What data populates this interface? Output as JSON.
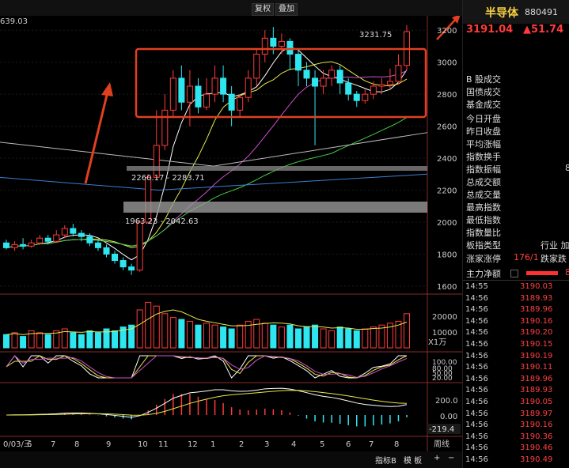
{
  "toolbar": {
    "fq_label": "复权",
    "overlay_label": "叠加"
  },
  "corner_value": "639.03",
  "colors": {
    "up": "#ff3b3b",
    "down": "#2ee6f0",
    "ma5": "#ffffff",
    "ma10": "#e8e84a",
    "ma20": "#d050d0",
    "ma60": "#40d040",
    "annotation": "#e04020",
    "background": "#000000"
  },
  "main_axis": {
    "ticks": [
      "3200",
      "3000",
      "2800",
      "2600",
      "2400",
      "2200",
      "2000",
      "1800",
      "1600"
    ]
  },
  "annotations": {
    "high_label": "3231.75",
    "band1": "2260.17 - 2283.71",
    "band2": "1963.23 - 2042.63"
  },
  "volume_axis": {
    "ticks": [
      "20000",
      "10000"
    ],
    "unit": "X1万"
  },
  "kdj_axis": {
    "ticks": [
      "100.00",
      "80.00",
      "50.00",
      "20.00"
    ]
  },
  "macd_axis": {
    "ticks": [
      "200.0",
      "0.00"
    ],
    "value": "-219.4"
  },
  "x_axis": {
    "labels": [
      "0/03/三",
      "6",
      "7",
      "8",
      "9",
      "10",
      "11",
      "12",
      "1",
      "2",
      "3",
      "4",
      "5",
      "6",
      "7",
      "8"
    ]
  },
  "bottom": {
    "indicator_label": "指标B",
    "template_label": "模 板",
    "period_label": "周线",
    "plus": "+",
    "minus": "−"
  },
  "panel": {
    "name": "半导体",
    "code": "880491",
    "price": "3191.04",
    "change": "▲51.74",
    "labels": [
      "B 股成交",
      "国债成交",
      "基金成交",
      "今日开盘",
      "昨日收盘",
      "平均涨幅",
      "指数换手",
      "指数振幅",
      "总成交额",
      "总成交量",
      "最高指数",
      "最低指数",
      "指数量比"
    ],
    "zhenfu_value": "8",
    "industry_label": "板指类型",
    "industry_value": "行业 加",
    "limit_label": "涨家涨停",
    "limit_value": "176/1",
    "limit_extra": "跌家跌",
    "capital_label": "主力净额",
    "capital_value": "8",
    "ticks": [
      {
        "time": "14:55",
        "price": "3190.03"
      },
      {
        "time": "14:56",
        "price": "3189.93"
      },
      {
        "time": "14:56",
        "price": "3189.96"
      },
      {
        "time": "14:56",
        "price": "3190.16"
      },
      {
        "time": "14:56",
        "price": "3190.20"
      },
      {
        "time": "14:56",
        "price": "3190.15"
      },
      {
        "time": "14:56",
        "price": "3190.19"
      },
      {
        "time": "14:56",
        "price": "3190.11"
      },
      {
        "time": "14:56",
        "price": "3189.96"
      },
      {
        "time": "14:56",
        "price": "3189.93"
      },
      {
        "time": "14:56",
        "price": "3190.05"
      },
      {
        "time": "14:56",
        "price": "3189.97"
      },
      {
        "time": "14:56",
        "price": "3190.16"
      },
      {
        "time": "14:56",
        "price": "3190.36"
      },
      {
        "time": "14:56",
        "price": "3190.46"
      },
      {
        "time": "14:56",
        "price": "3190.49"
      }
    ]
  },
  "chart_data": {
    "type": "candlestick",
    "title": "",
    "ylim": [
      1560,
      3290
    ],
    "candles": [
      [
        1870,
        1840,
        1890,
        1830
      ],
      [
        1840,
        1860,
        1880,
        1820
      ],
      [
        1860,
        1850,
        1900,
        1830
      ],
      [
        1850,
        1870,
        1890,
        1840
      ],
      [
        1870,
        1900,
        1920,
        1860
      ],
      [
        1900,
        1880,
        1920,
        1860
      ],
      [
        1880,
        1920,
        1950,
        1870
      ],
      [
        1920,
        1960,
        1980,
        1900
      ],
      [
        1960,
        1930,
        1990,
        1910
      ],
      [
        1930,
        1910,
        1950,
        1880
      ],
      [
        1910,
        1870,
        1930,
        1850
      ],
      [
        1870,
        1840,
        1890,
        1820
      ],
      [
        1840,
        1800,
        1860,
        1780
      ],
      [
        1800,
        1760,
        1820,
        1740
      ],
      [
        1760,
        1720,
        1780,
        1700
      ],
      [
        1720,
        1700,
        1740,
        1670
      ],
      [
        1700,
        2000,
        2010,
        1690
      ],
      [
        2000,
        2280,
        2300,
        1990
      ],
      [
        2280,
        2480,
        2700,
        2260
      ],
      [
        2480,
        2700,
        2800,
        2450
      ],
      [
        2700,
        2900,
        2950,
        2650
      ],
      [
        2900,
        2750,
        2980,
        2700
      ],
      [
        2750,
        2850,
        2950,
        2600
      ],
      [
        2850,
        2720,
        2900,
        2680
      ],
      [
        2720,
        2800,
        2900,
        2700
      ],
      [
        2800,
        2900,
        2980,
        2750
      ],
      [
        2900,
        2800,
        2980,
        2750
      ],
      [
        2800,
        2700,
        2850,
        2600
      ],
      [
        2700,
        2780,
        2800,
        2650
      ],
      [
        2780,
        2900,
        2950,
        2750
      ],
      [
        2900,
        3050,
        3080,
        2850
      ],
      [
        3050,
        3150,
        3200,
        3000
      ],
      [
        3150,
        3100,
        3220,
        3050
      ],
      [
        3100,
        3130,
        3180,
        3050
      ],
      [
        3130,
        3050,
        3150,
        2950
      ],
      [
        3050,
        2950,
        3080,
        2850
      ],
      [
        2950,
        2900,
        3000,
        2850
      ],
      [
        2900,
        2850,
        2950,
        2480
      ],
      [
        2850,
        2900,
        2950,
        2800
      ],
      [
        2900,
        2950,
        2980,
        2850
      ],
      [
        2950,
        2870,
        2980,
        2800
      ],
      [
        2870,
        2800,
        2900,
        2760
      ],
      [
        2800,
        2760,
        2820,
        2720
      ],
      [
        2760,
        2800,
        2830,
        2740
      ],
      [
        2800,
        2850,
        2880,
        2770
      ],
      [
        2850,
        2860,
        2900,
        2800
      ],
      [
        2860,
        2880,
        2960,
        2830
      ],
      [
        2880,
        2980,
        3050,
        2860
      ],
      [
        2980,
        3191,
        3232,
        2950
      ]
    ],
    "volume": [
      7000,
      8000,
      6000,
      9000,
      8000,
      7000,
      9000,
      10000,
      8000,
      7000,
      9000,
      8000,
      10000,
      9000,
      11000,
      12000,
      20000,
      24000,
      22000,
      18000,
      16000,
      15000,
      14000,
      12000,
      13000,
      12000,
      11000,
      10000,
      12000,
      14000,
      15000,
      13000,
      12000,
      11000,
      12000,
      10000,
      11000,
      12000,
      10000,
      9000,
      11000,
      10000,
      9000,
      10000,
      11000,
      12000,
      13000,
      14000,
      18000
    ]
  }
}
